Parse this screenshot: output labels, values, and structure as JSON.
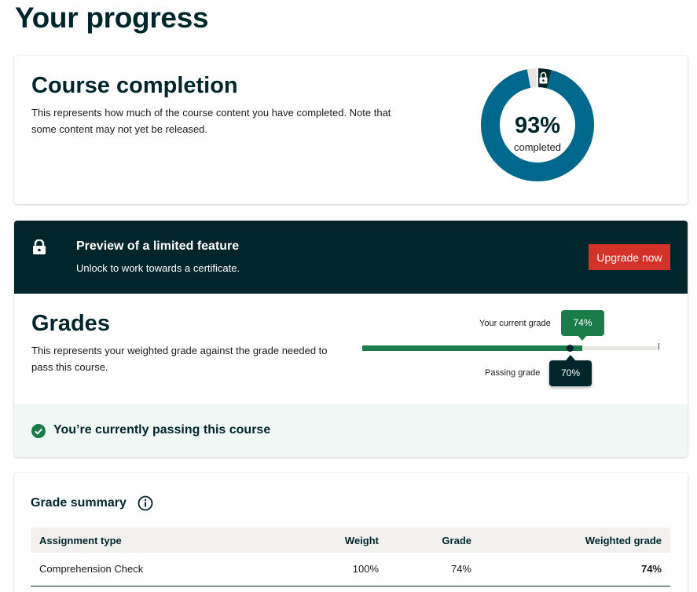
{
  "page_title": "Your progress",
  "completion": {
    "title": "Course completion",
    "description": "This represents how much of the course content you have completed. Note that some content may not yet be released.",
    "percent_label": "93%",
    "percent_value": 93,
    "locked_percent_value": 4,
    "completed_label": "completed",
    "colors": {
      "complete": "#00688d",
      "locked": "#00262b",
      "remaining": "#e8e6e3"
    },
    "locked_icon": "lock-icon"
  },
  "banner": {
    "icon": "lock-icon",
    "title": "Preview of a limited feature",
    "subtitle": "Unlock to work towards a certificate.",
    "button_label": "Upgrade now",
    "colors": {
      "background": "#00262b",
      "button": "#d23228"
    }
  },
  "grades": {
    "title": "Grades",
    "description": "This represents your weighted grade against the grade needed to pass this course.",
    "current_label": "Your current grade",
    "current_value_label": "74%",
    "current_value": 74,
    "passing_label": "Passing grade",
    "passing_value_label": "70%",
    "passing_value": 70,
    "status_icon": "check-circle-icon",
    "status_text": "You’re currently passing this course",
    "colors": {
      "current": "#1a7c4b",
      "passing": "#00262b",
      "track": "#e8e6e3",
      "status_bg": "#f0f7f4"
    }
  },
  "summary": {
    "title": "Grade summary",
    "info_icon": "info-icon",
    "columns": [
      "Assignment type",
      "Weight",
      "Grade",
      "Weighted grade"
    ],
    "rows": [
      [
        "Comprehension Check",
        "100%",
        "74%",
        "74%"
      ]
    ]
  }
}
